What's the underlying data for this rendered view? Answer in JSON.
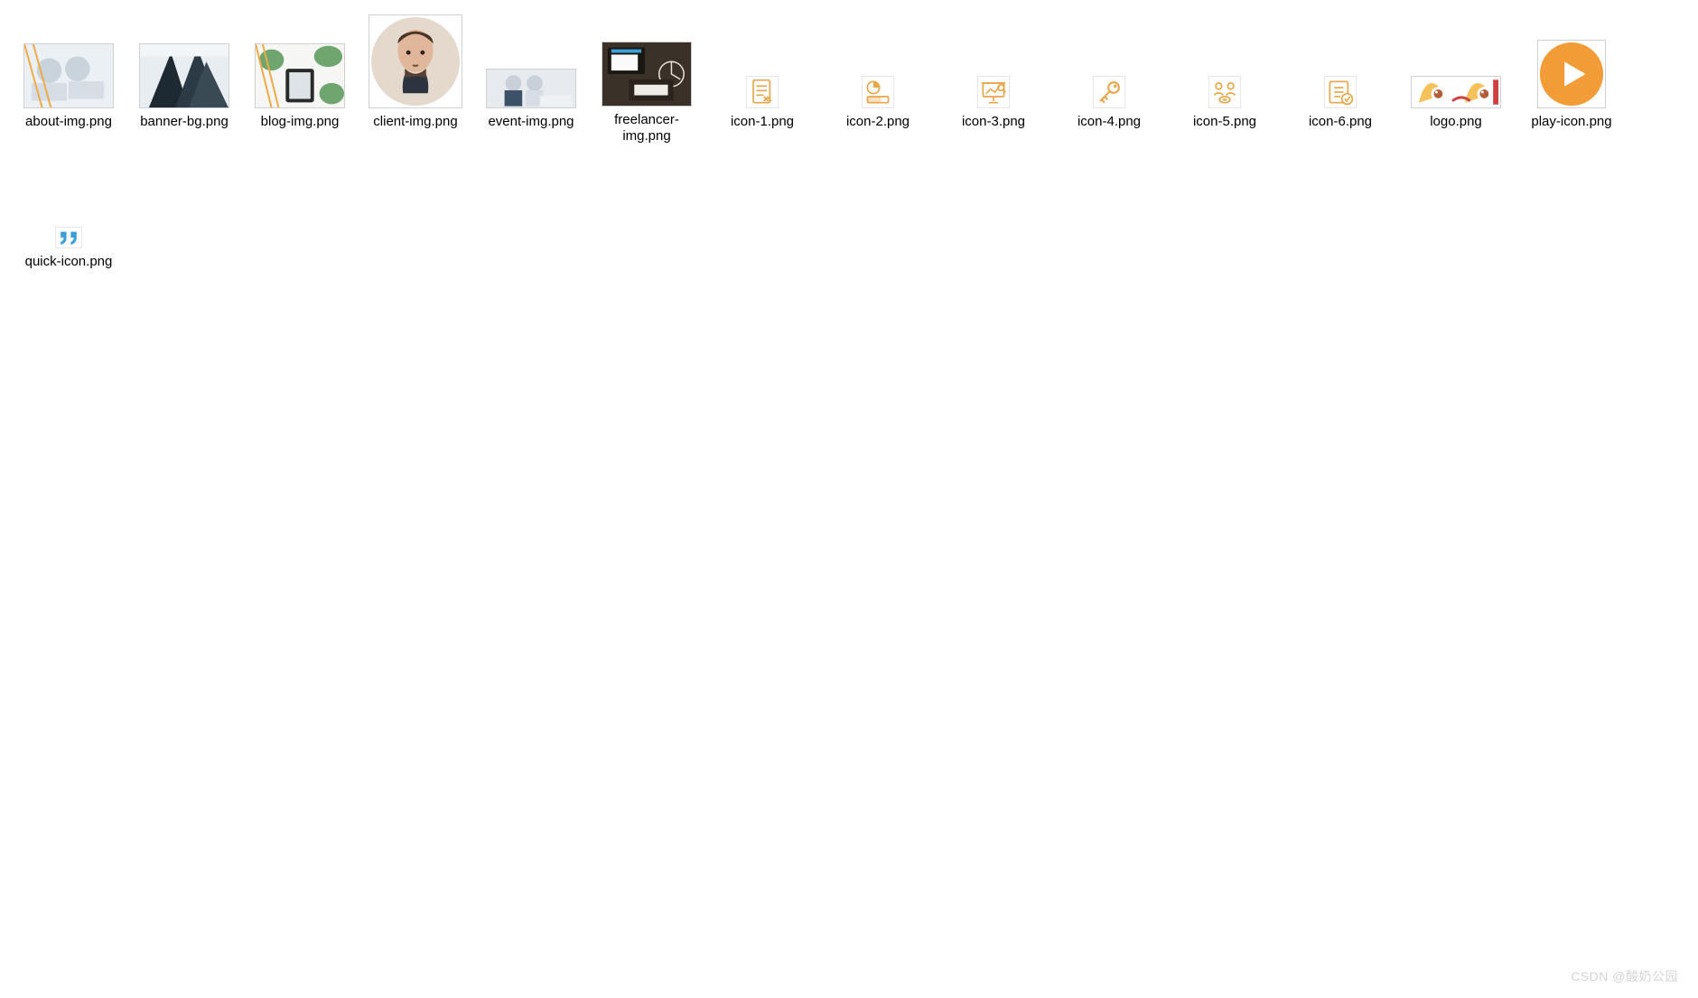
{
  "files": [
    {
      "name": "about-img.png",
      "thumb_type": "about"
    },
    {
      "name": "banner-bg.png",
      "thumb_type": "banner"
    },
    {
      "name": "blog-img.png",
      "thumb_type": "blog"
    },
    {
      "name": "client-img.png",
      "thumb_type": "client"
    },
    {
      "name": "event-img.png",
      "thumb_type": "event"
    },
    {
      "name": "freelancer-img.png",
      "thumb_type": "freelancer"
    },
    {
      "name": "icon-1.png",
      "thumb_type": "icon-doc"
    },
    {
      "name": "icon-2.png",
      "thumb_type": "icon-chart"
    },
    {
      "name": "icon-3.png",
      "thumb_type": "icon-present"
    },
    {
      "name": "icon-4.png",
      "thumb_type": "icon-key"
    },
    {
      "name": "icon-5.png",
      "thumb_type": "icon-people"
    },
    {
      "name": "icon-6.png",
      "thumb_type": "icon-check"
    },
    {
      "name": "logo.png",
      "thumb_type": "logo"
    },
    {
      "name": "play-icon.png",
      "thumb_type": "play"
    },
    {
      "name": "quick-icon.png",
      "thumb_type": "quote"
    }
  ],
  "watermark": "CSDN @酸奶公园",
  "colors": {
    "orange": "#e8a649",
    "blue": "#32a3e0",
    "circle_orange": "#f29c38",
    "quote_blue": "#3b9ed9"
  }
}
